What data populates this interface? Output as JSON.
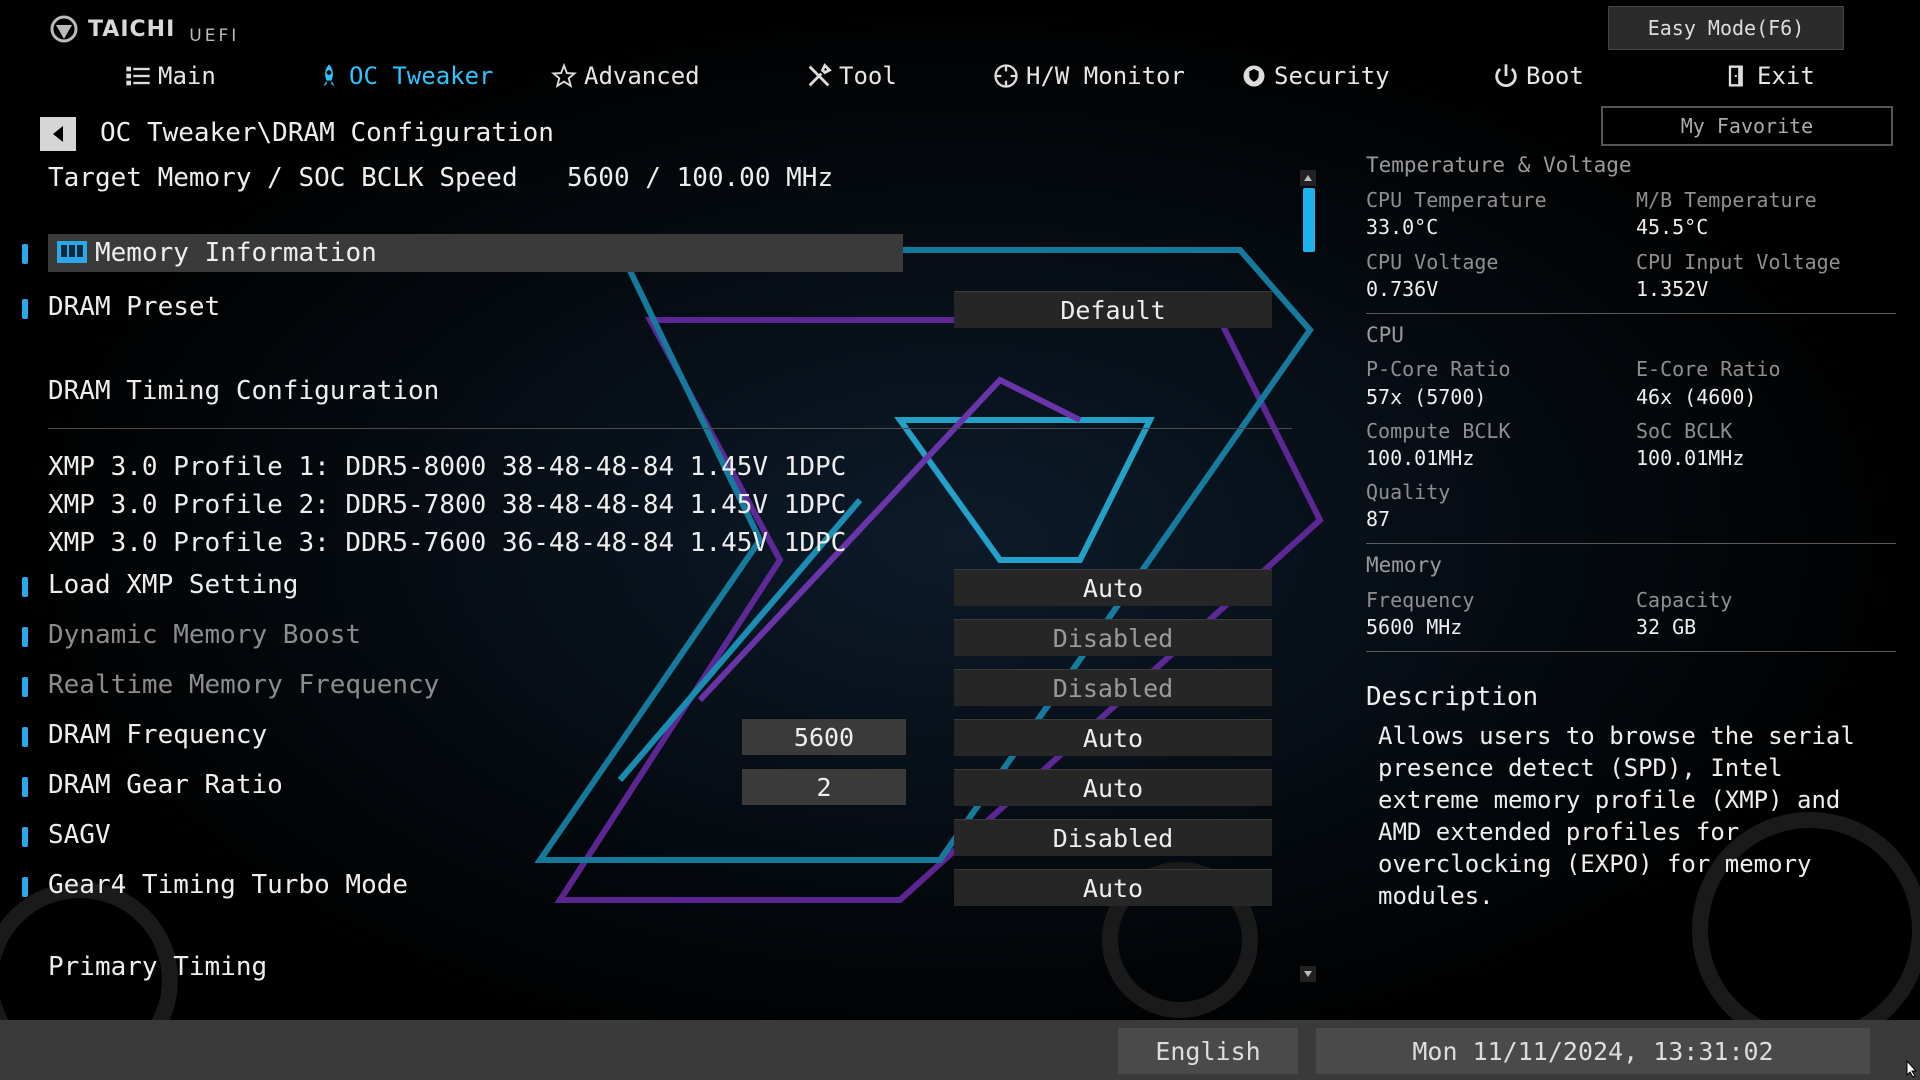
{
  "brand": {
    "name": "TAICHI",
    "sub": "UEFI"
  },
  "easy_mode": "Easy Mode(F6)",
  "my_favorite": "My Favorite",
  "tabs": [
    {
      "label": "Main",
      "icon": "list-icon"
    },
    {
      "label": "OC Tweaker",
      "icon": "rocket-icon",
      "active": true
    },
    {
      "label": "Advanced",
      "icon": "star-icon"
    },
    {
      "label": "Tool",
      "icon": "tools-icon"
    },
    {
      "label": "H/W Monitor",
      "icon": "monitor-icon"
    },
    {
      "label": "Security",
      "icon": "shield-icon"
    },
    {
      "label": "Boot",
      "icon": "power-icon"
    },
    {
      "label": "Exit",
      "icon": "exit-icon"
    }
  ],
  "breadcrumb": "OC Tweaker\\DRAM Configuration",
  "target": {
    "label": "Target Memory / SOC BCLK Speed",
    "value": "5600 / 100.00 MHz"
  },
  "rows": {
    "memory_information": "Memory Information",
    "dram_preset": {
      "label": "DRAM Preset",
      "value": "Default"
    },
    "timing_section": "DRAM Timing Configuration",
    "xmp_profiles": [
      "XMP 3.0 Profile 1: DDR5-8000 38-48-48-84 1.45V 1DPC",
      "XMP 3.0 Profile 2: DDR5-7800 38-48-48-84 1.45V 1DPC",
      "XMP 3.0 Profile 3: DDR5-7600 36-48-48-84 1.45V 1DPC"
    ],
    "load_xmp": {
      "label": "Load XMP Setting",
      "value": "Auto"
    },
    "dynamic_boost": {
      "label": "Dynamic Memory Boost",
      "value": "Disabled",
      "dim": true
    },
    "realtime_freq": {
      "label": "Realtime Memory Frequency",
      "value": "Disabled",
      "dim": true
    },
    "dram_frequency": {
      "label": "DRAM Frequency",
      "current": "5600",
      "value": "Auto"
    },
    "dram_gear": {
      "label": "DRAM Gear Ratio",
      "current": "2",
      "value": "Auto"
    },
    "sagv": {
      "label": "SAGV",
      "value": "Disabled"
    },
    "gear4": {
      "label": "Gear4 Timing Turbo Mode",
      "value": "Auto"
    },
    "primary_section": "Primary Timing"
  },
  "panel": {
    "temp_voltage_head": "Temperature & Voltage",
    "cpu_temp_label": "CPU Temperature",
    "cpu_temp": "33.0°C",
    "mb_temp_label": "M/B Temperature",
    "mb_temp": "45.5°C",
    "cpu_volt_label": "CPU Voltage",
    "cpu_volt": "0.736V",
    "cpu_in_volt_label": "CPU Input Voltage",
    "cpu_in_volt": "1.352V",
    "cpu_head": "CPU",
    "pcore_label": "P-Core Ratio",
    "pcore": "57x (5700)",
    "ecore_label": "E-Core Ratio",
    "ecore": "46x (4600)",
    "compute_bclk_label": "Compute BCLK",
    "compute_bclk": "100.01MHz",
    "soc_bclk_label": "SoC BCLK",
    "soc_bclk": "100.01MHz",
    "quality_label": "Quality",
    "quality": "87",
    "memory_head": "Memory",
    "freq_label": "Frequency",
    "freq": "5600 MHz",
    "capacity_label": "Capacity",
    "capacity": "32 GB"
  },
  "description": {
    "title": "Description",
    "text": "Allows users to browse the serial presence detect (SPD), Intel extreme memory profile (XMP) and AMD extended profiles for overclocking (EXPO) for memory modules."
  },
  "footer": {
    "language": "English",
    "datetime": "Mon 11/11/2024, 13:31:02"
  },
  "colors": {
    "accent": "#2ec5ff",
    "marker": "#2aa8e8",
    "thumb": "#1fb3ee"
  }
}
